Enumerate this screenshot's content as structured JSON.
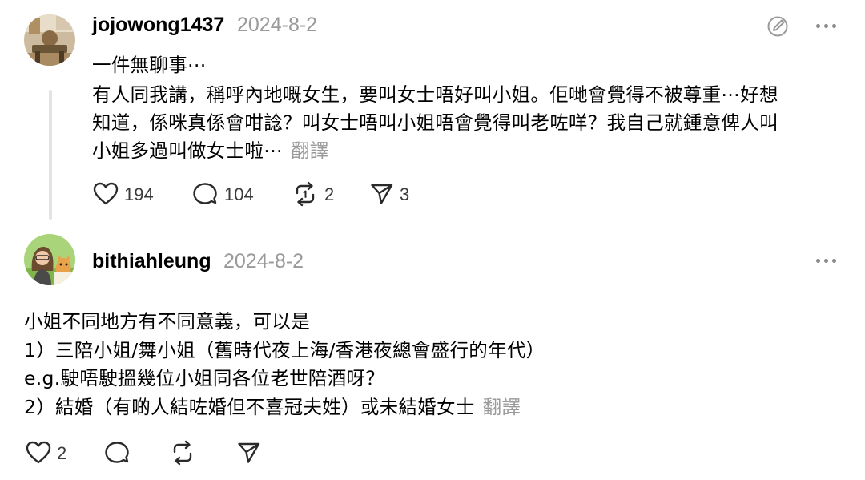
{
  "post1": {
    "username": "jojowong1437",
    "date": "2024-8-2",
    "lines": [
      "一件無聊事⋯",
      "有人同我講，稱呼內地嘅女生，要叫女士唔好叫小姐。佢哋會覺得不被尊重⋯好想",
      "知道，係咪真係會咁諗？叫女士唔叫小姐唔會覺得叫老咗咩？我自己就鍾意俾人叫",
      "小姐多過叫做女士啦⋯"
    ],
    "translate_label": "翻譯",
    "likes": "194",
    "replies": "104",
    "reposts": "2",
    "shares": "3"
  },
  "post2": {
    "username": "bithiahleung",
    "date": "2024-8-2",
    "lines": [
      "小姐不同地方有不同意義，可以是",
      "1）三陪小姐/舞小姐（舊時代夜上海/香港夜總會盛行的年代）",
      "e.g.駛唔駛搵幾位小姐同各位老世陪酒呀？",
      "2）結婚（有啲人結咗婚但不喜冠夫姓）或未結婚女士"
    ],
    "translate_label": "翻譯",
    "likes": "2"
  },
  "icons": {
    "like": "heart-icon",
    "reply": "comment-icon",
    "repost": "repost-icon",
    "share": "send-icon",
    "more": "more-icon",
    "edit": "edit-icon"
  }
}
